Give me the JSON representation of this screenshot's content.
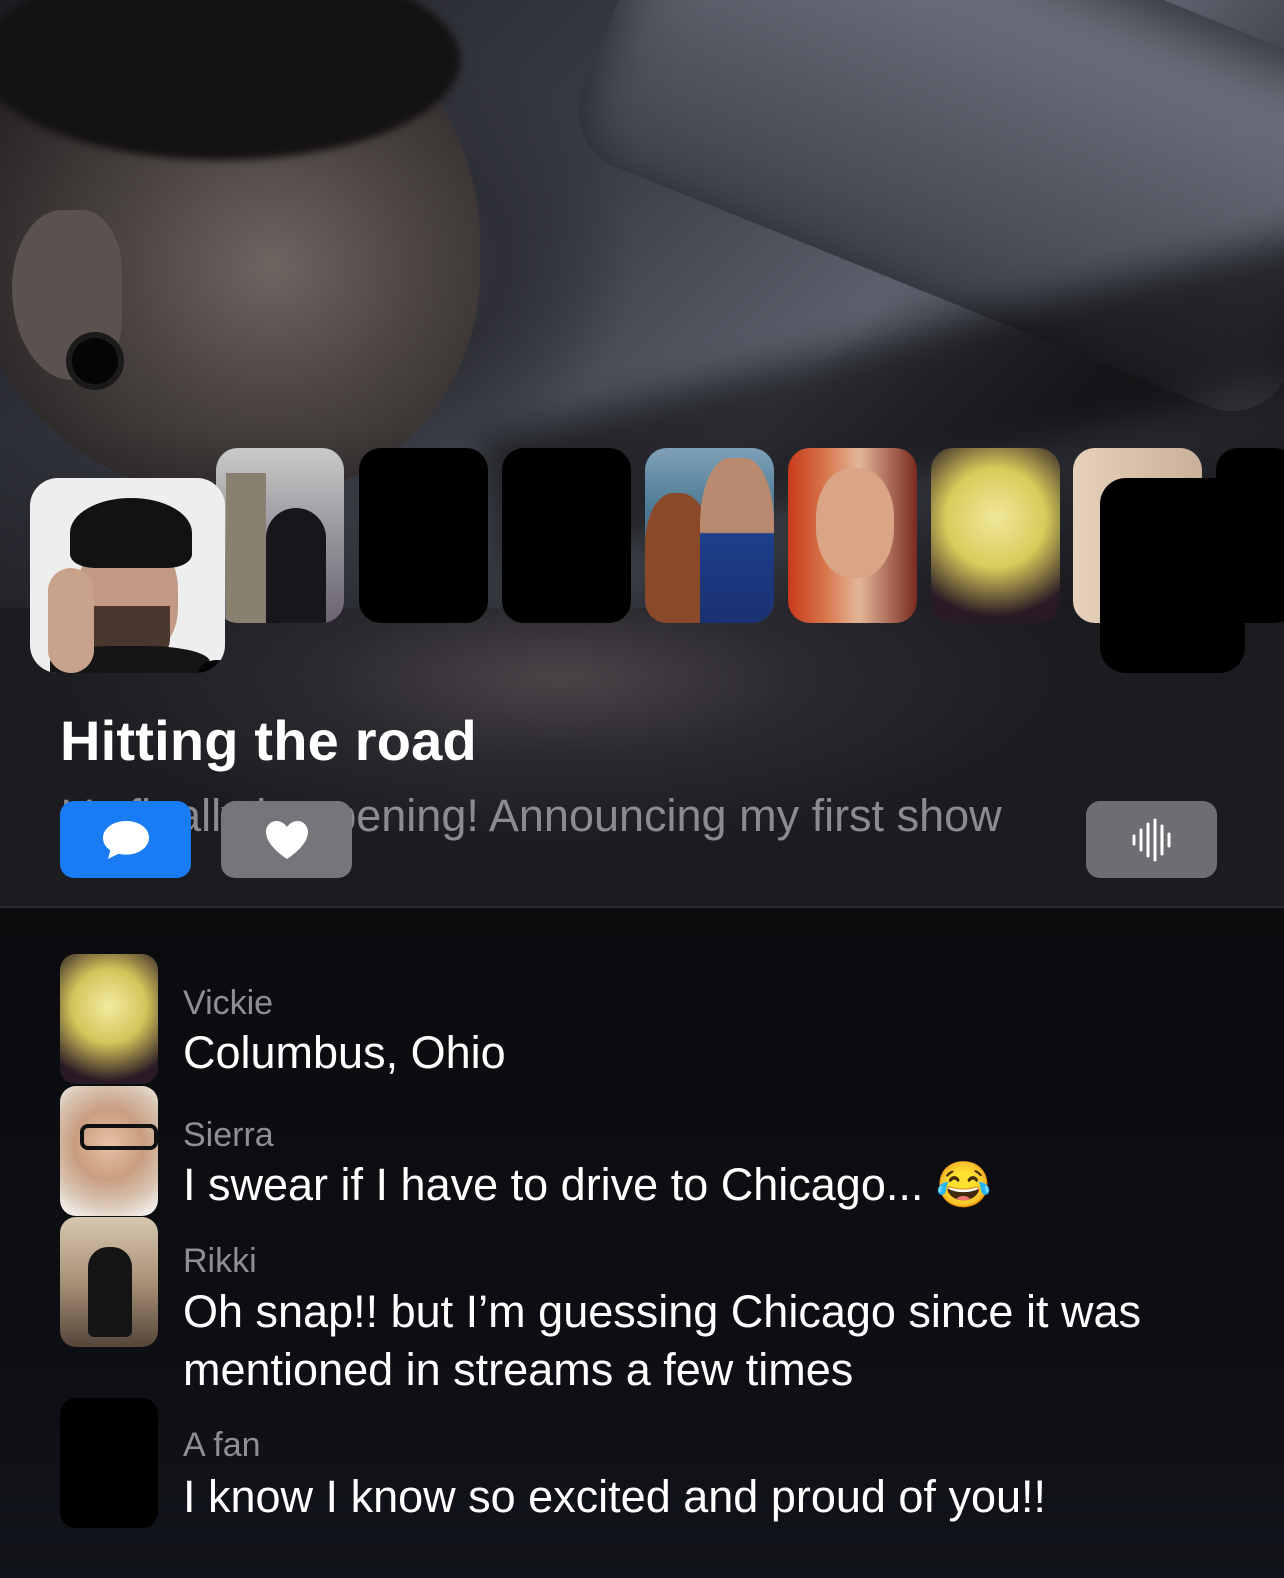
{
  "stream": {
    "title": "Hitting the road",
    "subtitle": "It's finally happening! Announcing my first show"
  },
  "controls": {
    "chat_icon": "speech-bubble-icon",
    "like_icon": "heart-icon",
    "audio_icon": "waveform-icon"
  },
  "comments": [
    {
      "name": "Vickie",
      "message": "Columbus, Ohio"
    },
    {
      "name": "Sierra",
      "message": "I swear if I have to drive to Chicago... 😂"
    },
    {
      "name": "Rikki",
      "message": "Oh snap!! but I’m guessing Chicago since it was mentioned in streams a few times"
    },
    {
      "name": "A fan",
      "message": "I know I know so excited and proud of you!!"
    }
  ],
  "colors": {
    "accent": "#1a7cf5",
    "button_gray": "#75757a",
    "muted_text": "#8e8e93"
  }
}
